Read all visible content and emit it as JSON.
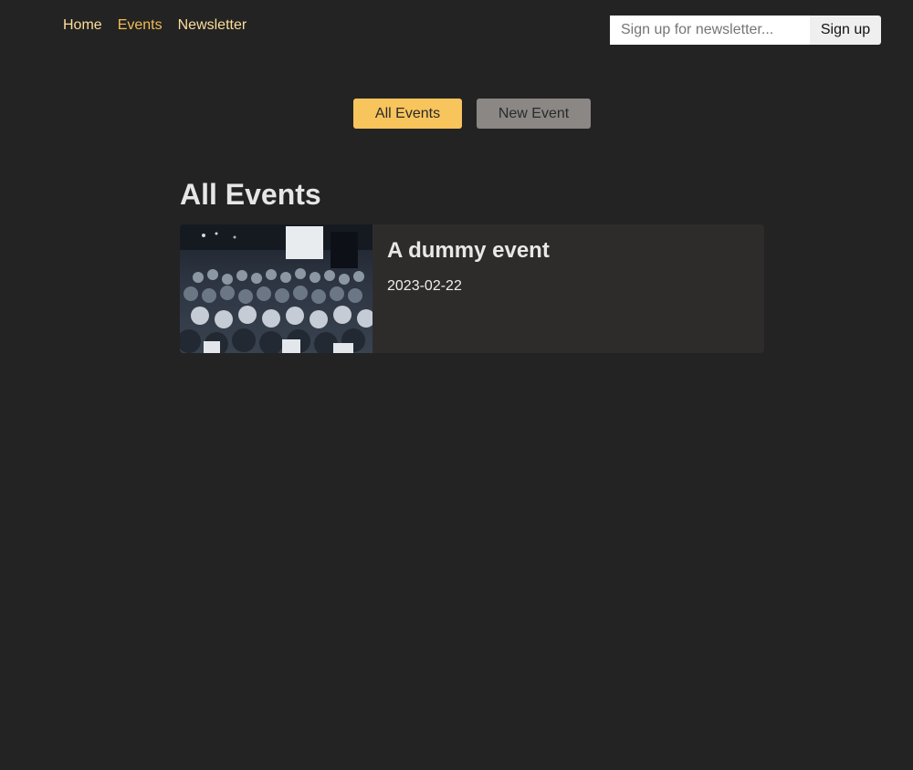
{
  "nav": {
    "items": [
      {
        "label": "Home",
        "active": false
      },
      {
        "label": "Events",
        "active": true
      },
      {
        "label": "Newsletter",
        "active": false
      }
    ]
  },
  "newsletter": {
    "placeholder": "Sign up for newsletter...",
    "value": "",
    "button_label": "Sign up"
  },
  "actions": {
    "all_events_label": "All Events",
    "new_event_label": "New Event"
  },
  "events_list": {
    "heading": "All Events",
    "items": [
      {
        "title": "A dummy event",
        "date": "2023-02-22",
        "image": "event-audience-photo"
      }
    ]
  },
  "colors": {
    "background": "#232323",
    "accent": "#f8c45c",
    "nav_link": "#fcde9b",
    "nav_link_active": "#f2bd54",
    "card_background": "#2e2c2b",
    "secondary_button": "#8b8785"
  }
}
